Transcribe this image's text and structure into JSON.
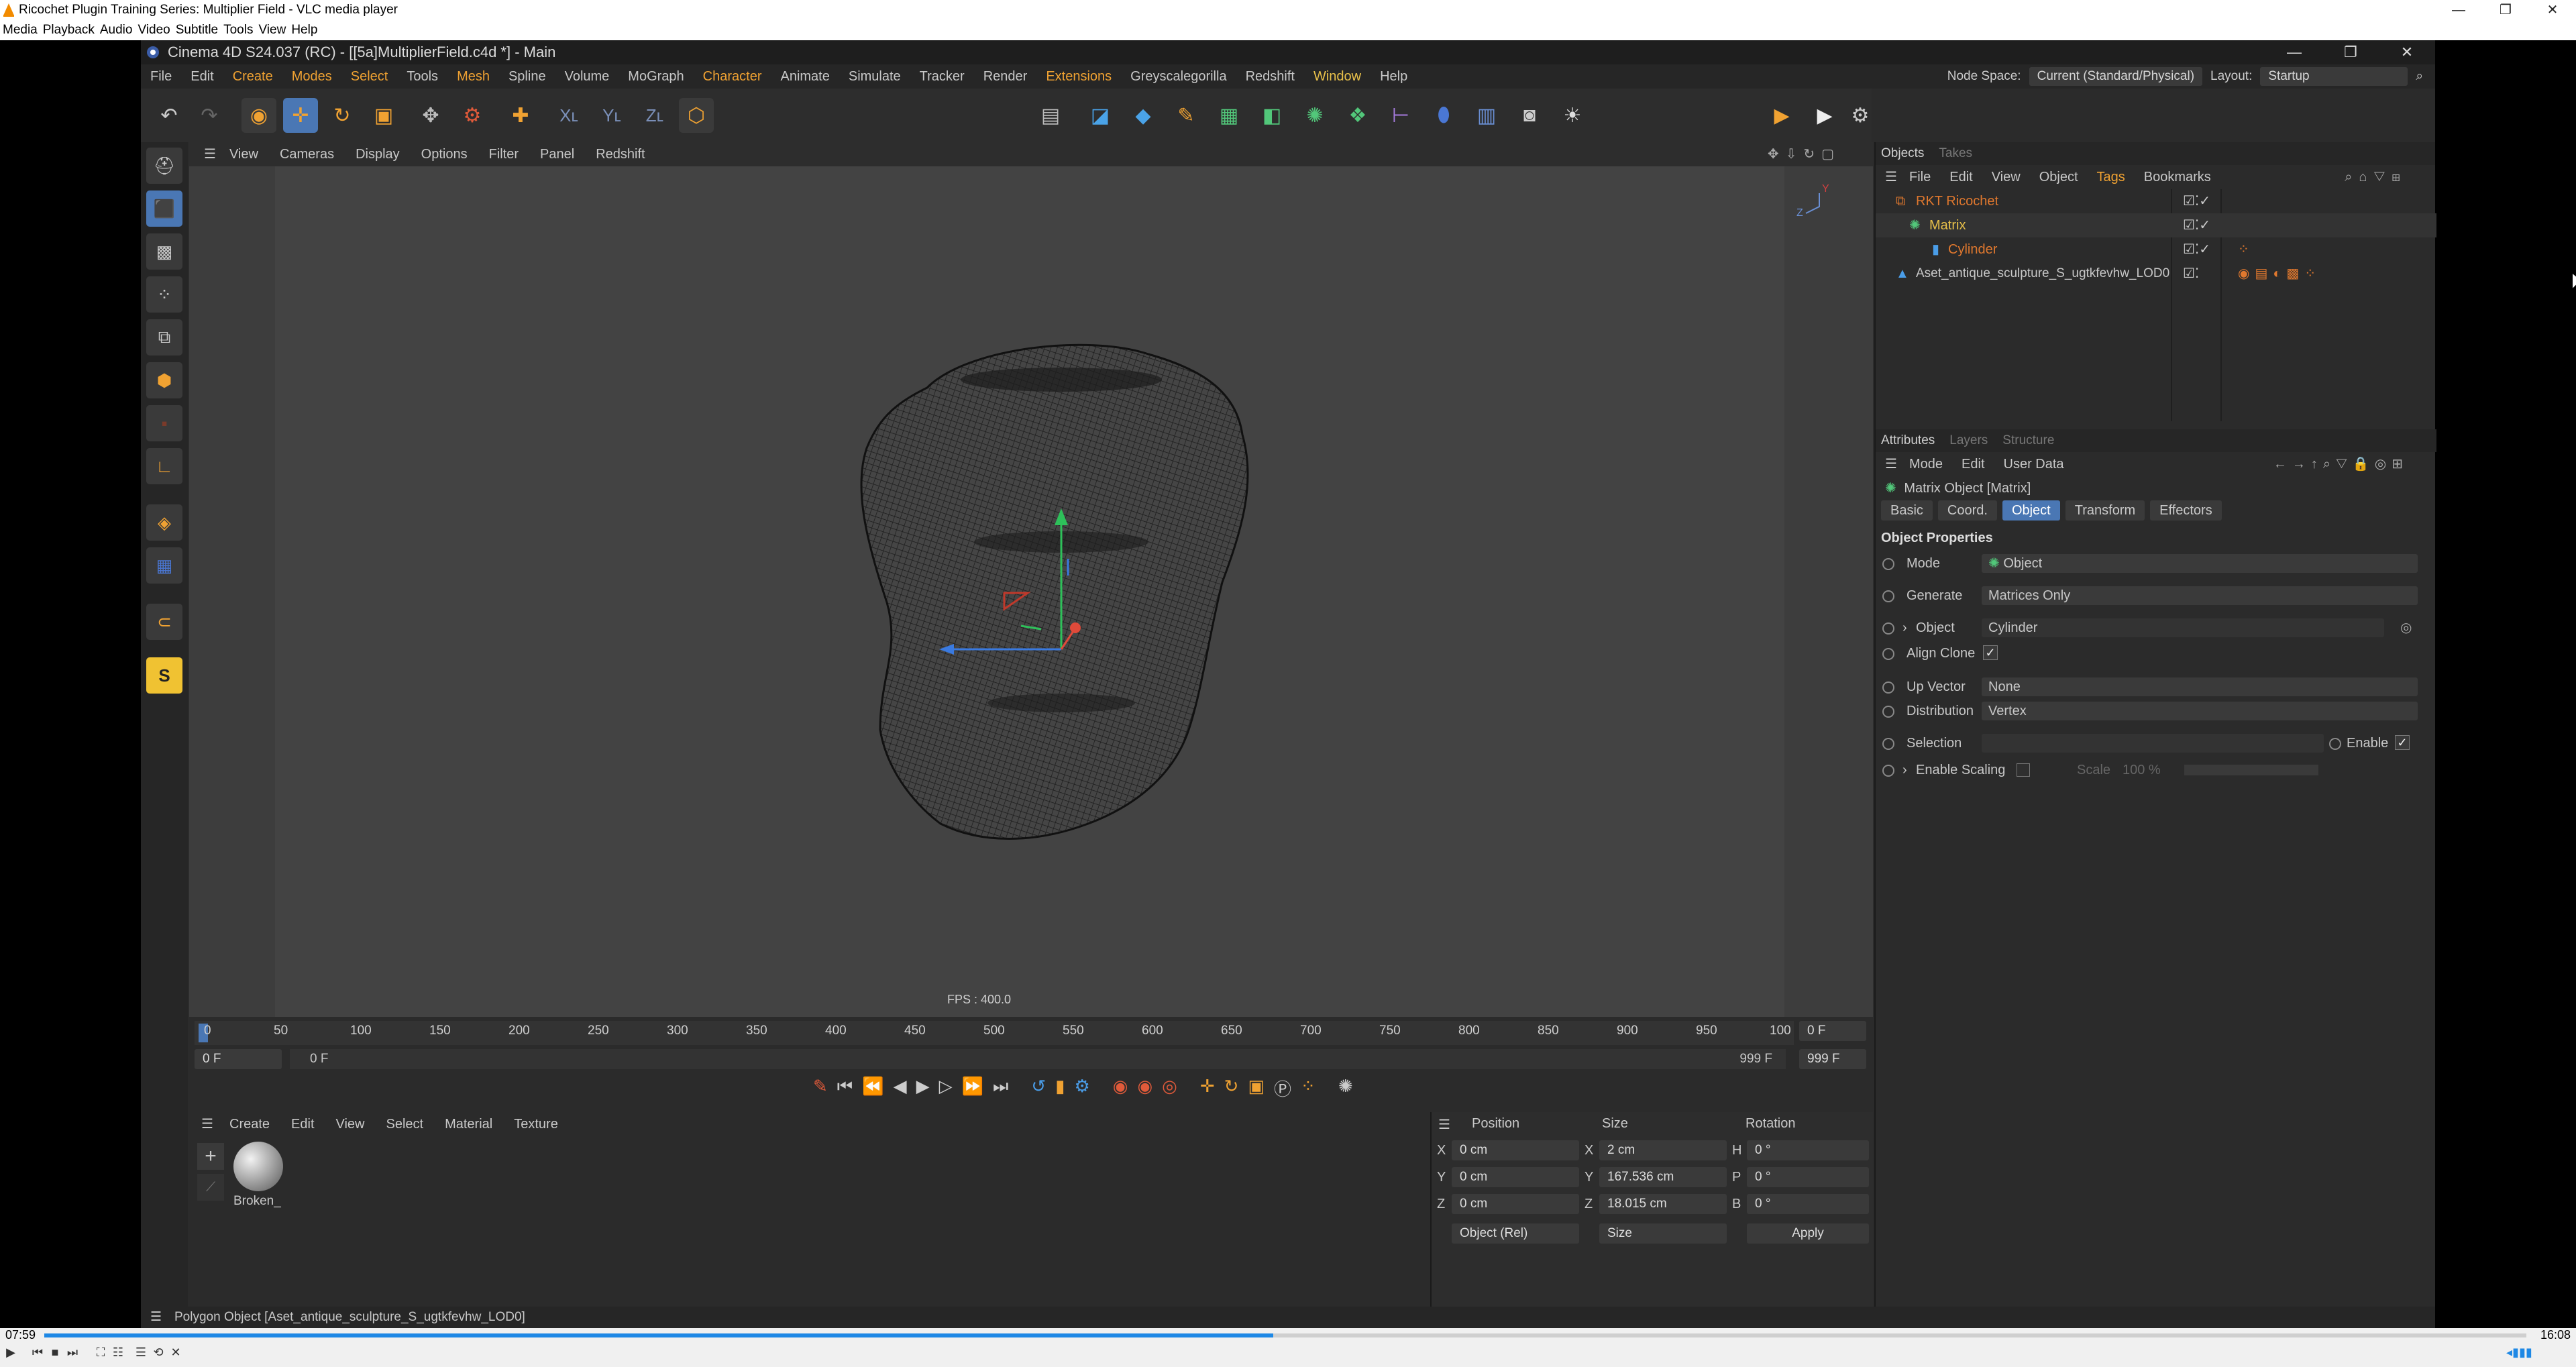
{
  "vlc": {
    "title": "Ricochet Plugin Training Series: Multiplier Field - VLC media player",
    "menu": [
      "Media",
      "Playback",
      "Audio",
      "Video",
      "Subtitle",
      "Tools",
      "View",
      "Help"
    ],
    "time_elapsed": "07:59",
    "time_total": "16:08",
    "progress": 0.495
  },
  "c4d": {
    "title": "Cinema 4D S24.037 (RC) - [[5a]MultiplierField.c4d *] - Main",
    "menu": [
      "File",
      "Edit",
      "Create",
      "Modes",
      "Select",
      "Tools",
      "Mesh",
      "Spline",
      "Volume",
      "MoGraph",
      "Character",
      "Animate",
      "Simulate",
      "Tracker",
      "Render",
      "Extensions",
      "Greyscalegorilla",
      "Redshift",
      "Window",
      "Help"
    ],
    "node_space_label": "Node Space:",
    "node_space_value": "Current (Standard/Physical)",
    "layout_label": "Layout:",
    "layout_value": "Startup"
  },
  "viewport": {
    "menu": [
      "View",
      "Cameras",
      "Display",
      "Options",
      "Filter",
      "Panel",
      "Redshift"
    ],
    "fps": "FPS : 400.0"
  },
  "timeline": {
    "ticks": [
      "0",
      "50",
      "100",
      "150",
      "200",
      "250",
      "300",
      "350",
      "400",
      "450",
      "500",
      "550",
      "600",
      "650",
      "700",
      "750",
      "800",
      "850",
      "900",
      "950",
      "100"
    ],
    "current_frame": "0 F",
    "start_field": "0 F",
    "range_start": "0 F",
    "range_end": "999 F",
    "end_field": "999 F"
  },
  "materials": {
    "menu": [
      "Create",
      "Edit",
      "View",
      "Select",
      "Material",
      "Texture"
    ],
    "items": [
      "Broken_"
    ]
  },
  "coords": {
    "headers": [
      "Position",
      "Size",
      "Rotation"
    ],
    "rows": [
      {
        "axis": "X",
        "pos": "0 cm",
        "size_axis": "X",
        "size": "2 cm",
        "rot_axis": "H",
        "rot": "0 °"
      },
      {
        "axis": "Y",
        "pos": "0 cm",
        "size_axis": "Y",
        "size": "167.536 cm",
        "rot_axis": "P",
        "rot": "0 °"
      },
      {
        "axis": "Z",
        "pos": "0 cm",
        "size_axis": "Z",
        "size": "18.015 cm",
        "rot_axis": "B",
        "rot": "0 °"
      }
    ],
    "mode": "Object (Rel)",
    "size_mode": "Size",
    "apply": "Apply"
  },
  "status": "Polygon Object [Aset_antique_sculpture_S_ugtkfevhw_LOD0]",
  "objects": {
    "tabs": [
      "Objects",
      "Takes"
    ],
    "menu": [
      "File",
      "Edit",
      "View",
      "Object",
      "Tags",
      "Bookmarks"
    ],
    "items": [
      {
        "name": "RKT Ricochet",
        "color": "#e0782e"
      },
      {
        "name": "Matrix",
        "color": "#e8c04a"
      },
      {
        "name": "Cylinder",
        "color": "#e0782e"
      },
      {
        "name": "Aset_antique_sculpture_S_ugtkfevhw_LOD0",
        "color": "#c8c8c8"
      }
    ]
  },
  "attributes": {
    "tabs": [
      "Attributes",
      "Layers",
      "Structure"
    ],
    "menu": [
      "Mode",
      "Edit",
      "User Data"
    ],
    "object_title": "Matrix Object [Matrix]",
    "sub_tabs": [
      "Basic",
      "Coord.",
      "Object",
      "Transform",
      "Effectors"
    ],
    "section": "Object Properties",
    "props": [
      {
        "label": "Mode",
        "value": "Object"
      },
      {
        "label": "Generate",
        "value": "Matrices Only"
      },
      {
        "label": "Object",
        "value": "Cylinder"
      },
      {
        "label": "Align Clone",
        "value": ""
      },
      {
        "label": "Up Vector",
        "value": "None"
      },
      {
        "label": "Distribution",
        "value": "Vertex"
      },
      {
        "label": "Selection",
        "value": ""
      },
      {
        "label": "Enable Scaling",
        "value": ""
      }
    ],
    "enable_label": "Enable",
    "scale_label": "Scale",
    "scale_value": "100 %"
  }
}
